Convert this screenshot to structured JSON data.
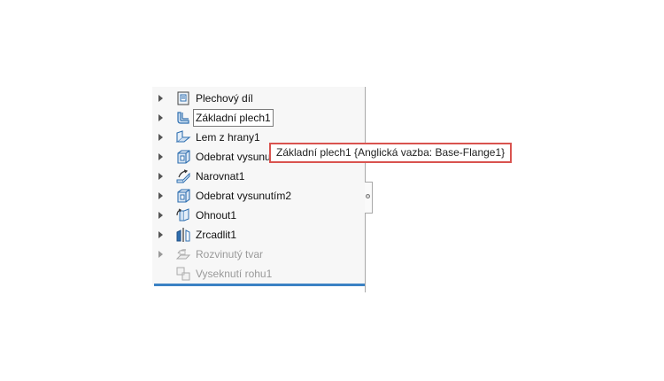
{
  "feature_tree": {
    "items": [
      {
        "label": "Plechový díl",
        "icon": "sheet-metal-icon",
        "expandable": true,
        "suppressed": false
      },
      {
        "label": "Základní plech1",
        "icon": "base-flange-icon",
        "expandable": true,
        "suppressed": false,
        "selected": true
      },
      {
        "label": "Lem z hrany1",
        "icon": "edge-flange-icon",
        "expandable": true,
        "suppressed": false
      },
      {
        "label": "Odebrat vysunu",
        "icon": "extruded-cut-icon",
        "expandable": true,
        "suppressed": false
      },
      {
        "label": "Narovnat1",
        "icon": "unfold-icon",
        "expandable": true,
        "suppressed": false
      },
      {
        "label": "Odebrat vysunutím2",
        "icon": "extruded-cut-icon",
        "expandable": true,
        "suppressed": false
      },
      {
        "label": "Ohnout1",
        "icon": "fold-icon",
        "expandable": true,
        "suppressed": false
      },
      {
        "label": "Zrcadlit1",
        "icon": "mirror-icon",
        "expandable": true,
        "suppressed": false
      },
      {
        "label": "Rozvinutý tvar",
        "icon": "flat-pattern-icon",
        "expandable": true,
        "suppressed": true
      },
      {
        "label": "Vyseknutí rohu1",
        "icon": "corner-relief-icon",
        "expandable": false,
        "suppressed": true
      }
    ]
  },
  "tooltip": {
    "text": "Základní plech1 {Anglická vazba: Base-Flange1}",
    "border_color": "#d9534f"
  },
  "colors": {
    "rollback_bar": "#3b82c4",
    "icon_blue": "#2f6fb0"
  }
}
